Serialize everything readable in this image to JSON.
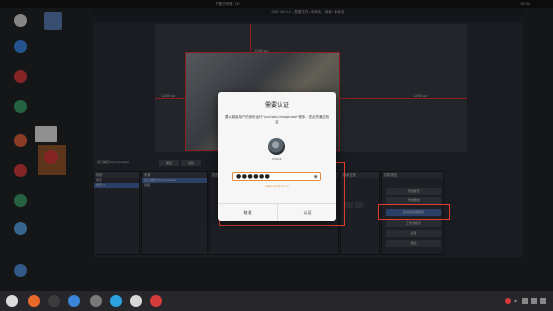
{
  "topbar": {
    "title": "下载已完成（3）",
    "clock": "15:32"
  },
  "desktop": {
    "icons": [
      {
        "name": "app-icon-1",
        "color": "#d8d8d8",
        "label": ""
      },
      {
        "name": "app-icon-2",
        "color": "#3d86e6",
        "label": ""
      },
      {
        "name": "app-icon-3",
        "color": "#d53b3b",
        "label": ""
      },
      {
        "name": "app-icon-4",
        "color": "#3b9f6a",
        "label": ""
      },
      {
        "name": "app-icon-5",
        "color": "#e2623b",
        "label": ""
      },
      {
        "name": "app-icon-6",
        "color": "#d53b3b",
        "label": ""
      },
      {
        "name": "app-icon-7",
        "color": "#3b9f6a",
        "label": ""
      },
      {
        "name": "app-icon-8",
        "color": "#5aa3e6",
        "label": ""
      }
    ],
    "file_label": "截图"
  },
  "obs": {
    "title": "OBS 26.0.2 - 配置文件: 未命名 - 场景: 未命名",
    "canvas_width_label": "1280 px",
    "canvas_left_label": "1280 px",
    "canvas_right_label": "1280 px",
    "source_label": "窗口捕获(XComposite)",
    "properties_btn": "属性",
    "filters_btn": "滤镜",
    "scenes_header": "场景",
    "scenes": [
      "场景",
      "场景 2"
    ],
    "sources_header": "来源",
    "sources": [
      "窗口捕获(XComposite)",
      "音频"
    ],
    "mixer_header": "混音器",
    "transitions_header": "场景过渡",
    "controls_header": "控制按钮",
    "controls": [
      "开始推流",
      "开始录制",
      "启动虚拟摄像机",
      "工作室模式",
      "设置",
      "退出"
    ]
  },
  "dialog": {
    "title": "需要认证",
    "message": "要以超级用户的身份运行\"/usr/sbin/modprobe\"程序，您必须通过验证",
    "username": "IHACK",
    "password_mask": "●●●●●●",
    "caps_warning": "Caps Lock is on",
    "cancel_label": "取消",
    "confirm_label": "认证"
  },
  "dock": {
    "icons": [
      {
        "name": "launcher-icon",
        "color": "#dcdcdc"
      },
      {
        "name": "firefox-icon",
        "color": "#e86a2a"
      },
      {
        "name": "files-icon",
        "color": "#3c3c3c"
      },
      {
        "name": "store-icon",
        "color": "#3b86d8"
      },
      {
        "name": "settings-icon",
        "color": "#7a7a7a"
      },
      {
        "name": "telegram-icon",
        "color": "#2aa3e0"
      },
      {
        "name": "wps-icon",
        "color": "#d8d8d8"
      },
      {
        "name": "obs-icon",
        "color": "#d53b3b"
      }
    ],
    "tray_text": "中"
  }
}
